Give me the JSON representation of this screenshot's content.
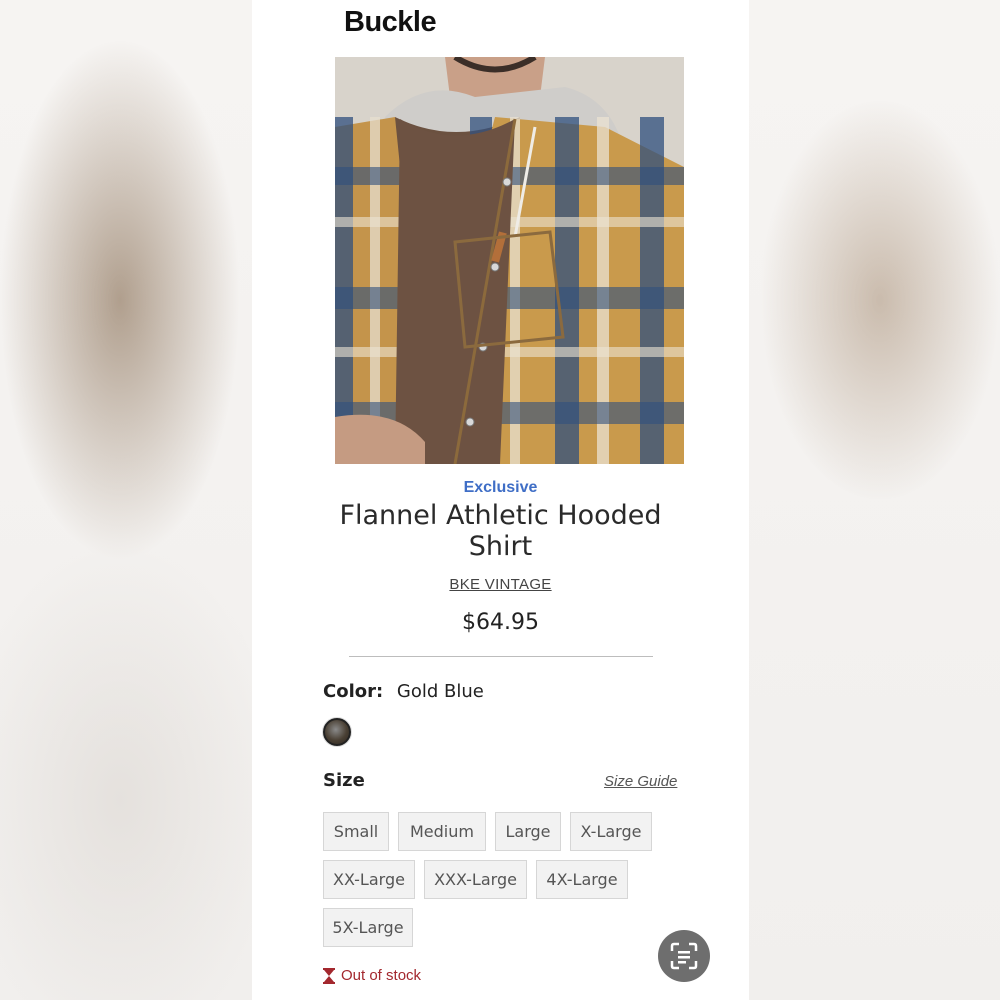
{
  "header": {
    "logo_text": "Buckle"
  },
  "product": {
    "badge": "Exclusive",
    "title": "Flannel Athletic Hooded Shirt",
    "brand": "BKE VINTAGE",
    "price": "$64.95",
    "image_icon": "plaid-hooded-shirt-photo"
  },
  "color": {
    "label": "Color:",
    "value": "Gold Blue",
    "swatch_icon": "color-swatch"
  },
  "size": {
    "label": "Size",
    "guide_label": "Size Guide",
    "options": [
      "Small",
      "Medium",
      "Large",
      "X-Large",
      "XX-Large",
      "XXX-Large",
      "4X-Large",
      "5X-Large"
    ]
  },
  "stock": {
    "icon": "hourglass-icon",
    "text": "Out of stock"
  },
  "overlay": {
    "icon": "visual-search-lens-icon"
  },
  "colors": {
    "accent_blue": "#3f6ec6",
    "out_of_stock_red": "#a3282e"
  }
}
